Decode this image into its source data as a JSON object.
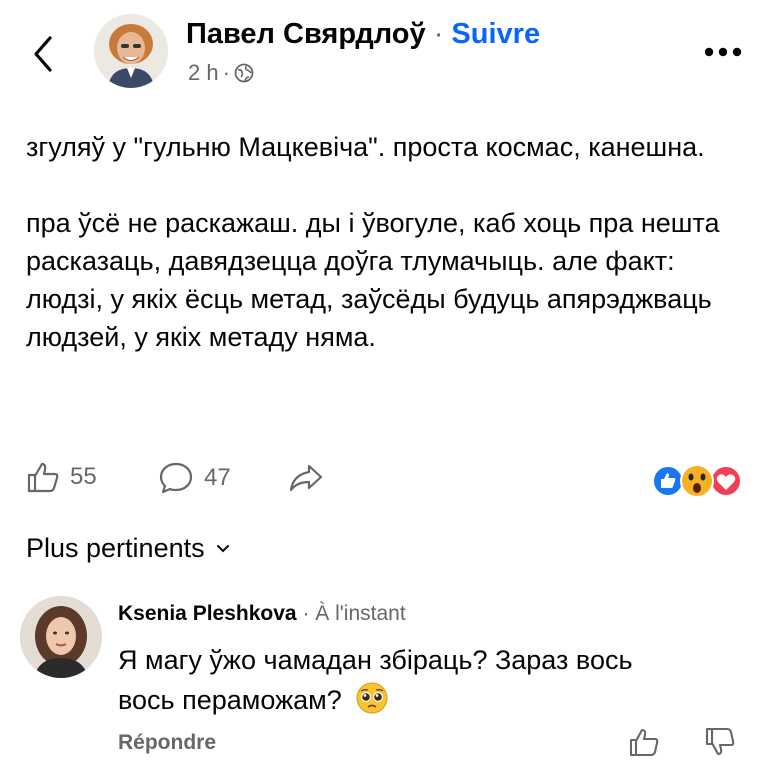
{
  "header": {
    "author_name": "Павел Свярдлоў",
    "separator": "·",
    "follow_label": "Suivre",
    "time": "2 h",
    "time_separator": "·"
  },
  "post": {
    "paragraphs": [
      "згуляў у \"гульню Мацкевіча\". проста космас, канешна.",
      "пра ўсё не раскажаш. ды і ўвогуле, каб хоць пра нешта расказаць, давядзецца доўга тлумачыць. але факт: людзі, у якіх ёсць метад, заўсёды будуць апярэджваць людзей, у якіх метаду няма."
    ]
  },
  "actions": {
    "likes": "55",
    "comments": "47",
    "reactions": [
      "like",
      "wow",
      "love"
    ]
  },
  "sort": {
    "label": "Plus pertinents"
  },
  "comment": {
    "author_name": "Ksenia Pleshkova",
    "separator": "·",
    "time": "À l'instant",
    "text": "Я магу ўжо чамадан збіраць? Зараз вось вось пераможам?",
    "emoji": "pleading-face",
    "reply_label": "Répondre"
  },
  "colors": {
    "accent": "#0866ff",
    "secondary_text": "#65676b",
    "like_reaction": "#1877f2",
    "love_reaction": "#f33e58",
    "wow_reaction": "#f7b125"
  }
}
